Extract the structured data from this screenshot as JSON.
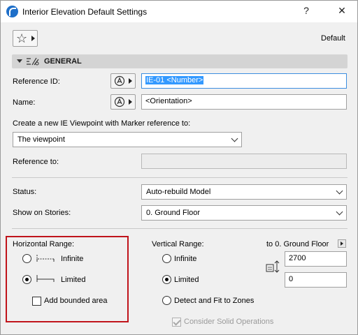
{
  "window": {
    "title": "Interior Elevation Default Settings",
    "help_symbol": "?",
    "close_symbol": "✕"
  },
  "favorites": {
    "icon": "star-icon",
    "label": "Default"
  },
  "section": {
    "title": "GENERAL"
  },
  "fields": {
    "reference_id": {
      "label": "Reference ID:",
      "value": "IE-01 <Number>"
    },
    "name": {
      "label": "Name:",
      "value": "<Orientation>"
    },
    "create_label": "Create a new IE Viewpoint with Marker reference to:",
    "viewpoint_select": "The viewpoint",
    "reference_to": {
      "label": "Reference to:",
      "value": ""
    },
    "status": {
      "label": "Status:",
      "value": "Auto-rebuild Model"
    },
    "stories": {
      "label": "Show on Stories:",
      "value": "0. Ground Floor"
    }
  },
  "horizontal_range": {
    "title": "Horizontal Range:",
    "options": [
      "Infinite",
      "Limited"
    ],
    "selected": "Limited",
    "add_bounded_area": "Add bounded area",
    "add_bounded_area_checked": false
  },
  "vertical_range": {
    "title": "Vertical Range:",
    "to_story": "to 0. Ground Floor",
    "options": [
      "Infinite",
      "Limited",
      "Detect and Fit to Zones"
    ],
    "selected": "Limited",
    "top_value": "2700",
    "bottom_value": "0",
    "consider_solid_operations": "Consider Solid Operations",
    "consider_checked": true
  },
  "colors": {
    "accent": "#3399ff",
    "highlight_box": "#c0141b"
  }
}
